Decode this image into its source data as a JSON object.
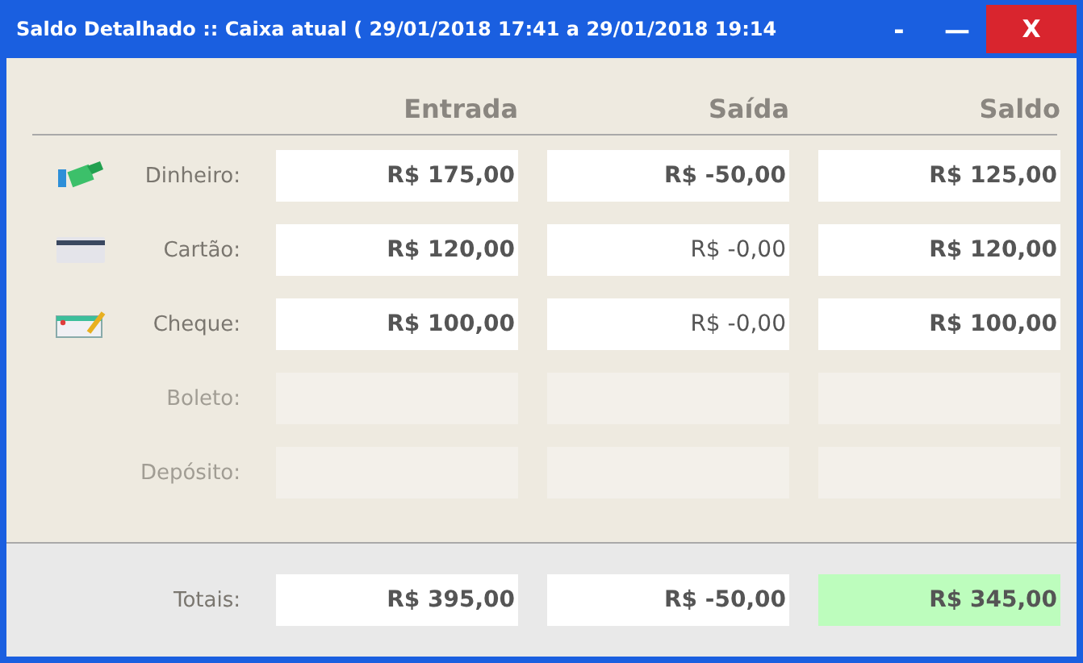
{
  "window": {
    "title": "Saldo Detalhado :: Caixa atual ( 29/01/2018 17:41 a 29/01/2018 19:14",
    "controls": [
      "-",
      "—",
      "X"
    ]
  },
  "columns": [
    "Entrada",
    "Saída",
    "Saldo"
  ],
  "rows": [
    {
      "label": "Dinheiro:",
      "kind": "cash",
      "disabled": false,
      "cells": [
        {
          "value": "R$ 175,00",
          "bold": true
        },
        {
          "value": "R$ -50,00",
          "bold": true
        },
        {
          "value": "R$ 125,00",
          "bold": true
        }
      ]
    },
    {
      "label": "Cartão:",
      "kind": "card",
      "disabled": false,
      "cells": [
        {
          "value": "R$ 120,00",
          "bold": true
        },
        {
          "value": "R$ -0,00",
          "bold": false
        },
        {
          "value": "R$ 120,00",
          "bold": true
        }
      ]
    },
    {
      "label": "Cheque:",
      "kind": "cheque",
      "disabled": false,
      "cells": [
        {
          "value": "R$ 100,00",
          "bold": true
        },
        {
          "value": "R$ -0,00",
          "bold": false
        },
        {
          "value": "R$ 100,00",
          "bold": true
        }
      ]
    },
    {
      "label": "Boleto:",
      "disabled": true
    },
    {
      "label": "Depósito:",
      "disabled": true
    }
  ],
  "totals": {
    "label": "Totais:",
    "cells": [
      {
        "value": "R$ 395,00",
        "highlighted": false
      },
      {
        "value": "R$ -50,00",
        "highlighted": false
      },
      {
        "value": "R$ 345,00",
        "highlighted": true
      }
    ]
  }
}
